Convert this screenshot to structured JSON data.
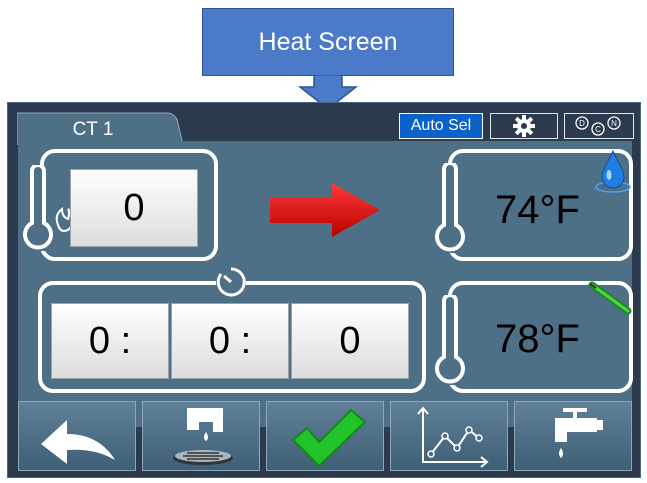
{
  "callout": {
    "label": "Heat Screen",
    "color": "#4b7bc8"
  },
  "tab": {
    "label": "CT 1"
  },
  "top_buttons": {
    "auto_sel": "Auto Sel",
    "settings_icon": "gear-icon",
    "mode_icon": "dcn-mode-icon"
  },
  "heat_setpoint": {
    "value": "0",
    "icon": "thermometer-flame-icon"
  },
  "heating_indicator": {
    "icon": "red-arrow-icon"
  },
  "timer": {
    "hours": "0 :",
    "minutes": "0 :",
    "seconds": "0",
    "icon": "timer-icon"
  },
  "water_temp": {
    "value": "74°F",
    "icon": "water-drop-icon"
  },
  "probe_temp": {
    "value": "78°F",
    "icon": "probe-icon"
  },
  "bottom_buttons": [
    {
      "name": "back",
      "icon": "back-arrow-icon"
    },
    {
      "name": "drain",
      "icon": "drain-icon"
    },
    {
      "name": "confirm",
      "icon": "green-check-icon"
    },
    {
      "name": "graph",
      "icon": "graph-icon"
    },
    {
      "name": "fill",
      "icon": "water-tap-icon"
    }
  ],
  "colors": {
    "panel": "#4d7087",
    "frame": "#2b3b4d",
    "accent_blue": "#0b62c9",
    "arrow_red": "#e01010",
    "check_green": "#22c42a"
  }
}
